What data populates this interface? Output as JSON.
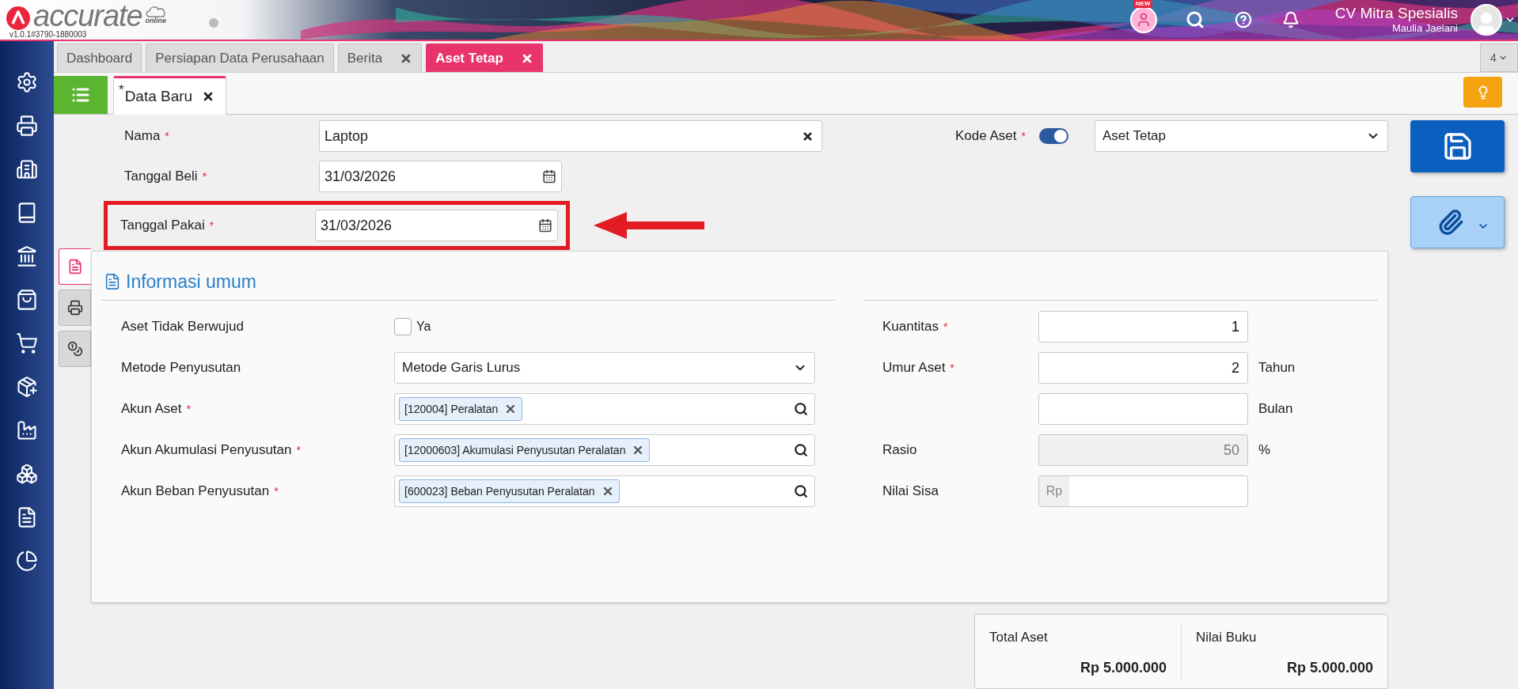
{
  "app": {
    "logo": "accurate",
    "logo_sub": "online",
    "version": "v1.0.1#3790-1880003",
    "badge": "NEW",
    "company": "CV Mitra Spesialis",
    "user": "Maulia Jaelani"
  },
  "tabs": [
    {
      "label": "Dashboard",
      "closable": false,
      "selected": false
    },
    {
      "label": "Persiapan Data Perusahaan",
      "closable": false,
      "selected": false
    },
    {
      "label": "Berita",
      "closable": true,
      "selected": false
    },
    {
      "label": "Aset Tetap",
      "closable": true,
      "selected": true
    }
  ],
  "tab_count": "4",
  "subtabs": [
    {
      "label": "Data Baru",
      "mark": "*",
      "closable": true,
      "selected": true
    }
  ],
  "form": {
    "fields": [
      {
        "label": "Nama",
        "required_mark": "*",
        "kind": "text",
        "value": "Laptop",
        "highlighted": false
      },
      {
        "label": "Tanggal Beli",
        "required_mark": "*",
        "kind": "date",
        "value": "31/03/2026",
        "highlighted": false
      },
      {
        "label": "Tanggal Pakai",
        "required_mark": "*",
        "kind": "date",
        "value": "31/03/2026",
        "highlighted": true
      }
    ],
    "kode_aset": {
      "label": "Kode Aset",
      "required_mark": "*",
      "on": true,
      "value": "Aset Tetap"
    }
  },
  "side_tabs": [
    {
      "selected": true
    },
    {
      "selected": false
    },
    {
      "selected": false
    }
  ],
  "section": {
    "title": "Informasi umum",
    "left_fields": [
      {
        "label": "Aset Tidak Berwujud",
        "kind": "checkbox",
        "checked": false,
        "option": "Ya"
      },
      {
        "label": "Metode Penyusutan",
        "kind": "select",
        "value": "Metode Garis Lurus"
      },
      {
        "label": "Akun Aset",
        "required_mark": "*",
        "kind": "tags",
        "tags": [
          "[120004] Peralatan"
        ]
      },
      {
        "label": "Akun Akumulasi Penyusutan",
        "required_mark": "*",
        "kind": "tags",
        "tags": [
          "[12000603] Akumulasi Penyusutan Peralatan"
        ]
      },
      {
        "label": "Akun Beban Penyusutan",
        "required_mark": "*",
        "kind": "tags",
        "tags": [
          "[600023] Beban Penyusutan Peralatan"
        ]
      }
    ],
    "right_fields": [
      {
        "label": "Kuantitas",
        "required_mark": "*",
        "kind": "number",
        "value": "1",
        "disabled": false
      },
      {
        "label": "Umur Aset",
        "required_mark": "*",
        "kind": "number",
        "value": "2",
        "unit": "Tahun",
        "disabled": false
      },
      {
        "kind": "number",
        "unit": "Bulan",
        "disabled": false
      },
      {
        "label": "Rasio",
        "kind": "number",
        "value": "50",
        "unit": "%",
        "disabled": true
      },
      {
        "label": "Nilai Sisa",
        "kind": "money",
        "prefix": "Rp",
        "disabled": false
      }
    ]
  },
  "totals": [
    {
      "label": "Total Aset",
      "value": "Rp 5.000.000"
    },
    {
      "label": "Nilai Buku",
      "value": "Rp 5.000.000"
    }
  ]
}
